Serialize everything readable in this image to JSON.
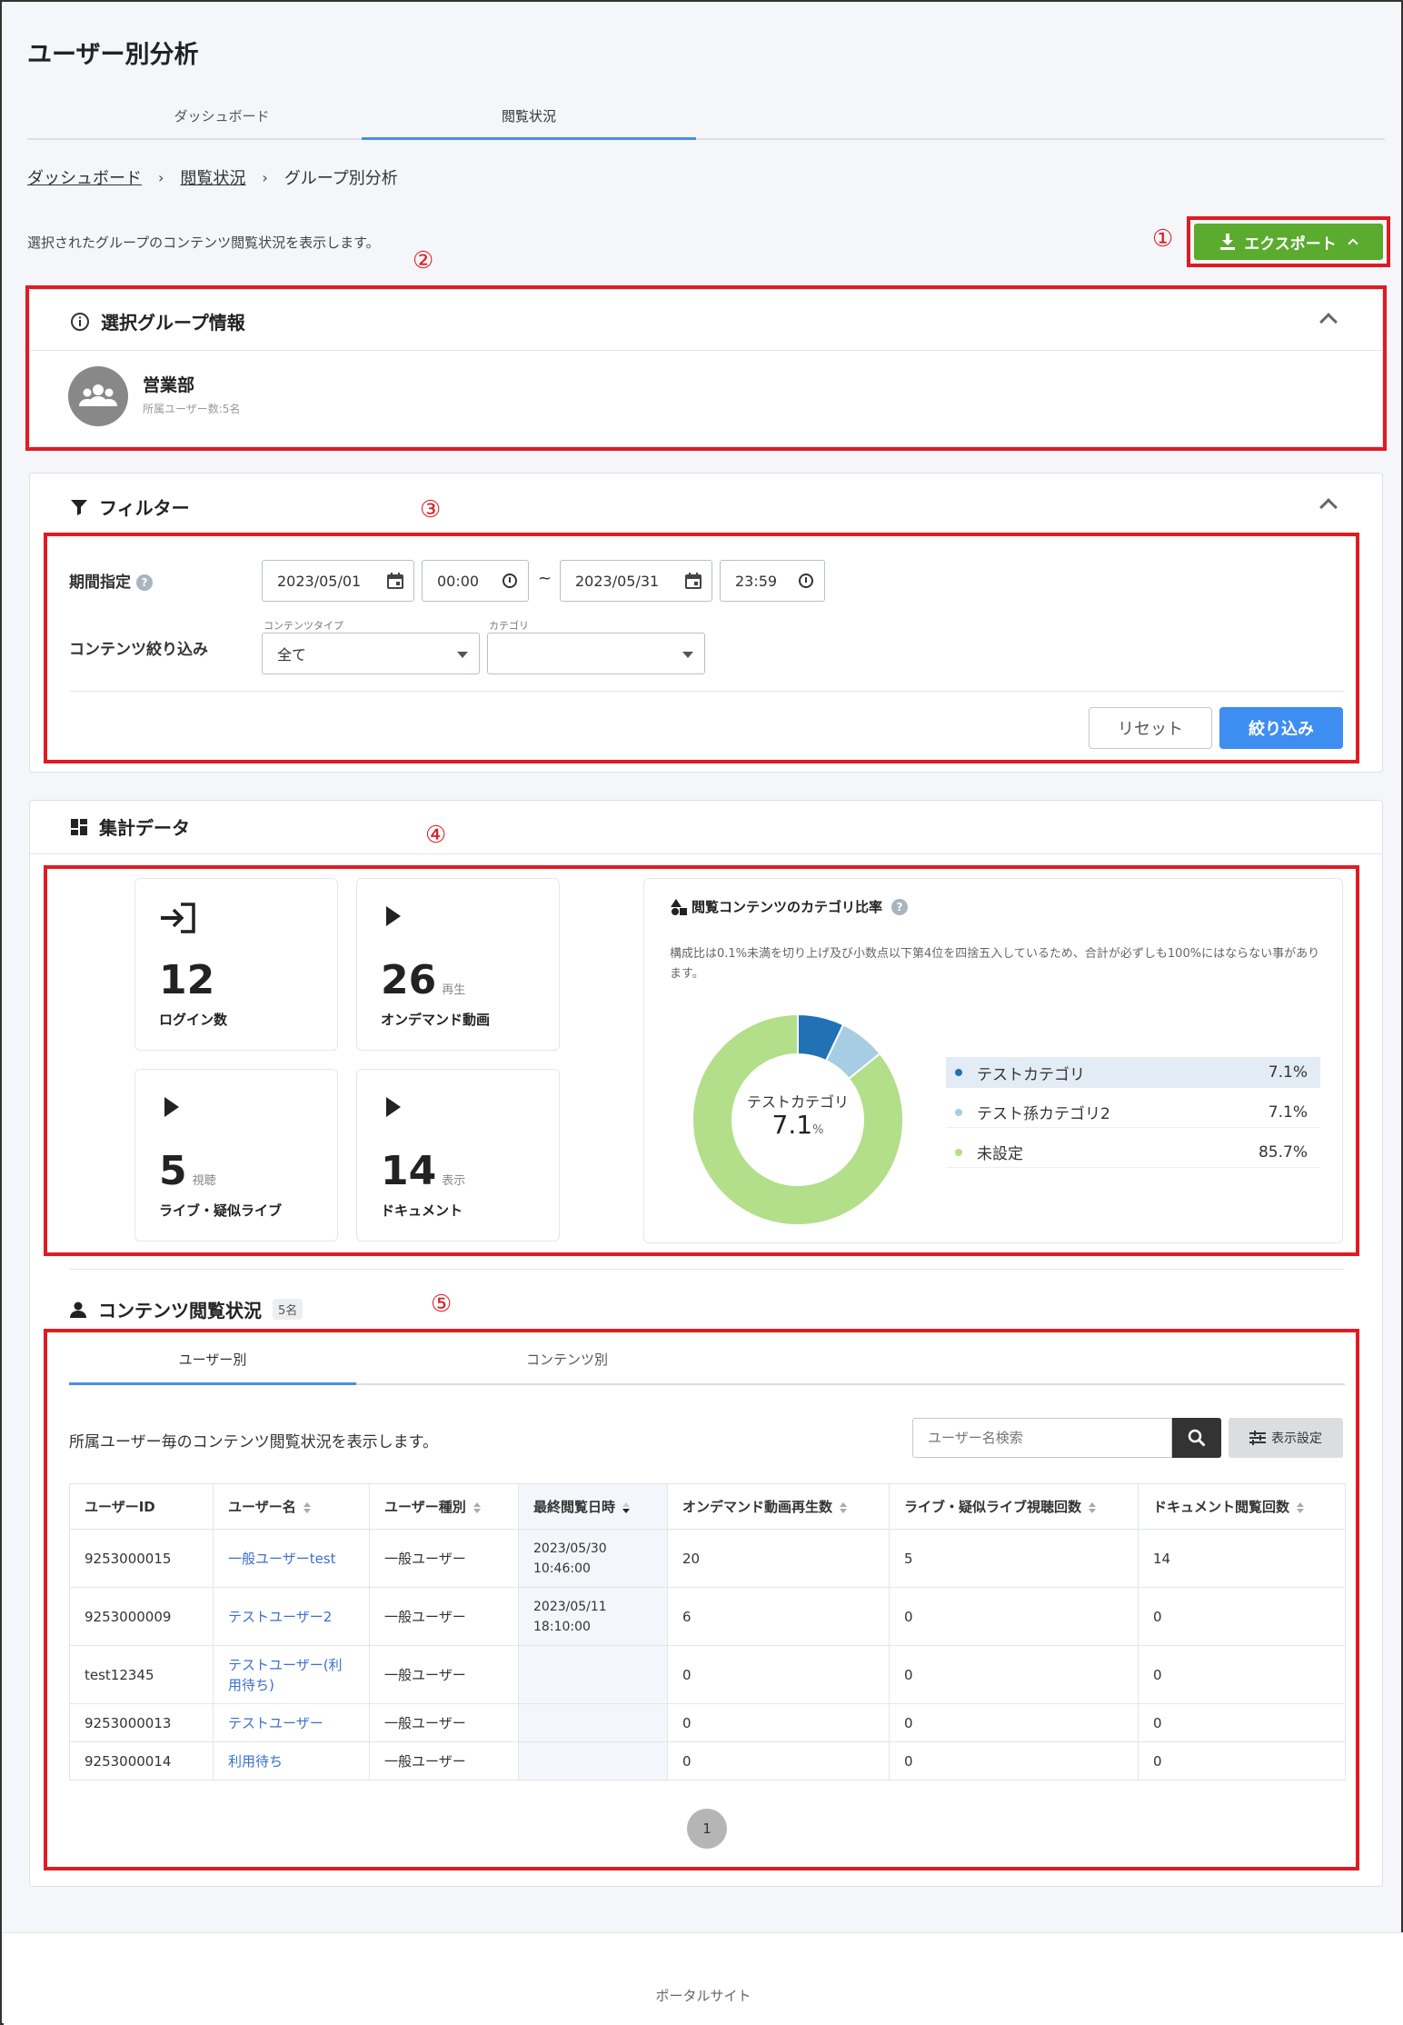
{
  "page": {
    "title": "ユーザー別分析",
    "tabs": [
      "ダッシュボード",
      "閲覧状況"
    ],
    "breadcrumb": [
      "ダッシュボード",
      "閲覧状況",
      "グループ別分析"
    ],
    "description": "選択されたグループのコンテンツ閲覧状況を表示します。",
    "export_label": "エクスポート"
  },
  "annotations": [
    "①",
    "②",
    "③",
    "④",
    "⑤"
  ],
  "group_info": {
    "title": "選択グループ情報",
    "name": "営業部",
    "members": "所属ユーザー数:5名"
  },
  "filter": {
    "title": "フィルター",
    "period_label": "期間指定",
    "start_date": "2023/05/01",
    "start_time": "00:00",
    "tilde": "~",
    "end_date": "2023/05/31",
    "end_time": "23:59",
    "content_label": "コンテンツ絞り込み",
    "content_type_caption": "コンテンツタイプ",
    "content_type_value": "全て",
    "category_caption": "カテゴリ",
    "category_value": "",
    "reset_label": "リセット",
    "apply_label": "絞り込み"
  },
  "summary": {
    "title": "集計データ",
    "stats": [
      {
        "value": "12",
        "unit": "",
        "label": "ログイン数",
        "icon": "login-icon"
      },
      {
        "value": "26",
        "unit": "再生",
        "label": "オンデマンド動画",
        "icon": "play-icon"
      },
      {
        "value": "5",
        "unit": "視聴",
        "label": "ライブ・疑似ライブ",
        "icon": "play-icon"
      },
      {
        "value": "14",
        "unit": "表示",
        "label": "ドキュメント",
        "icon": "play-icon"
      }
    ],
    "ratio": {
      "title": "閲覧コンテンツのカテゴリ比率",
      "note": "構成比は0.1%未満を切り上げ及び小数点以下第4位を四捨五入しているため、合計が必ずしも100%にはならない事があります。",
      "center_label": "テストカテゴリ",
      "center_value": "7.1",
      "center_unit": "%",
      "items": [
        {
          "name": "テストカテゴリ",
          "pct": "7.1%",
          "value": 7.1,
          "color": "#2171b5"
        },
        {
          "name": "テスト孫カテゴリ2",
          "pct": "7.1%",
          "value": 7.1,
          "color": "#a6cde3"
        },
        {
          "name": "未設定",
          "pct": "85.7%",
          "value": 85.7,
          "color": "#b3de8a"
        }
      ]
    }
  },
  "browse": {
    "title": "コンテンツ閲覧状況",
    "count_badge": "5名",
    "tabs": [
      "ユーザー別",
      "コンテンツ別"
    ],
    "description": "所属ユーザー毎のコンテンツ閲覧状況を表示します。",
    "search_placeholder": "ユーザー名検索",
    "settings_label": "表示設定",
    "columns": [
      "ユーザーID",
      "ユーザー名",
      "ユーザー種別",
      "最終閲覧日時",
      "オンデマンド動画再生数",
      "ライブ・疑似ライブ視聴回数",
      "ドキュメント閲覧回数"
    ],
    "rows": [
      [
        "9253000015",
        "一般ユーザーtest",
        "一般ユーザー",
        "2023/05/30 10:46:00",
        "20",
        "5",
        "14"
      ],
      [
        "9253000009",
        "テストユーザー2",
        "一般ユーザー",
        "2023/05/11 18:10:00",
        "6",
        "0",
        "0"
      ],
      [
        "test12345",
        "テストユーザー(利用待ち)",
        "一般ユーザー",
        "",
        "0",
        "0",
        "0"
      ],
      [
        "9253000013",
        "テストユーザー",
        "一般ユーザー",
        "",
        "0",
        "0",
        "0"
      ],
      [
        "9253000014",
        "利用待ち",
        "一般ユーザー",
        "",
        "0",
        "0",
        "0"
      ]
    ],
    "page": "1"
  },
  "footer": {
    "label": "ポータルサイト"
  },
  "colors": {
    "accent": "#3e8ef2",
    "export": "#5aab2e",
    "annotation": "#e01b22",
    "link": "#3b6fd0"
  }
}
